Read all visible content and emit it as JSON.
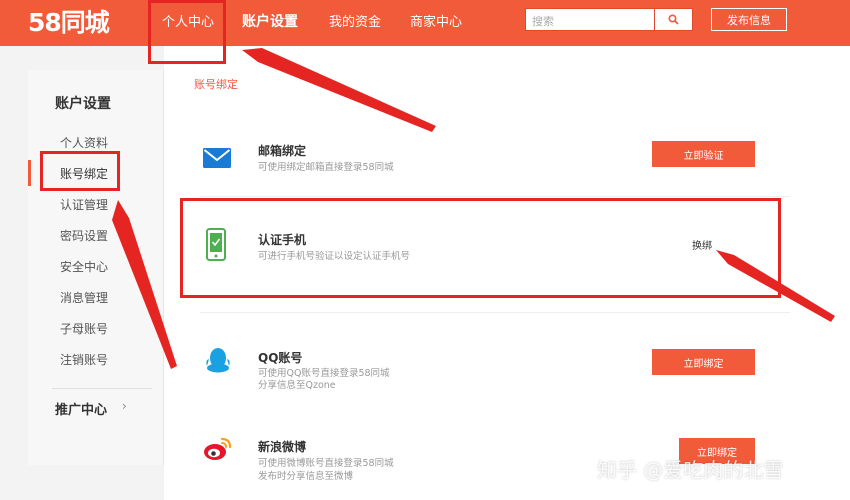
{
  "header": {
    "logo": "58同城",
    "nav": [
      "个人中心",
      "账户设置",
      "我的资金",
      "商家中心"
    ],
    "search_placeholder": "搜索",
    "publish": "发布信息"
  },
  "sidebar": {
    "title": "账户设置",
    "items": [
      "个人资料",
      "账号绑定",
      "认证管理",
      "密码设置",
      "安全中心",
      "消息管理",
      "子母账号",
      "注销账号"
    ],
    "promo": "推广中心",
    "promo_chevron": "›"
  },
  "main": {
    "breadcrumb": "账号绑定",
    "cards": [
      {
        "title": "邮箱绑定",
        "desc": [
          "可使用绑定邮箱直接登录58同城"
        ],
        "action": "立即验证"
      },
      {
        "title": "认证手机",
        "desc": [
          "可进行手机号验证以设定认证手机号"
        ],
        "action": "换绑"
      },
      {
        "title": "QQ账号",
        "desc": [
          "可使用QQ账号直接登录58同城",
          "分享信息至Qzone"
        ],
        "action": "立即绑定"
      },
      {
        "title": "新浪微博",
        "desc": [
          "可使用微博账号直接登录58同城",
          "发布时分享信息至微博"
        ],
        "action": "立即绑定"
      }
    ]
  },
  "watermark": "知乎 @爱吃肉的北雪",
  "colors": {
    "brand": "#f25b3a",
    "annotation": "#e52521",
    "mail_icon": "#1a7bd6",
    "phone_icon": "#4caf50",
    "qq_icon": "#1ba0e2",
    "weibo_icon": "#e6162d"
  }
}
